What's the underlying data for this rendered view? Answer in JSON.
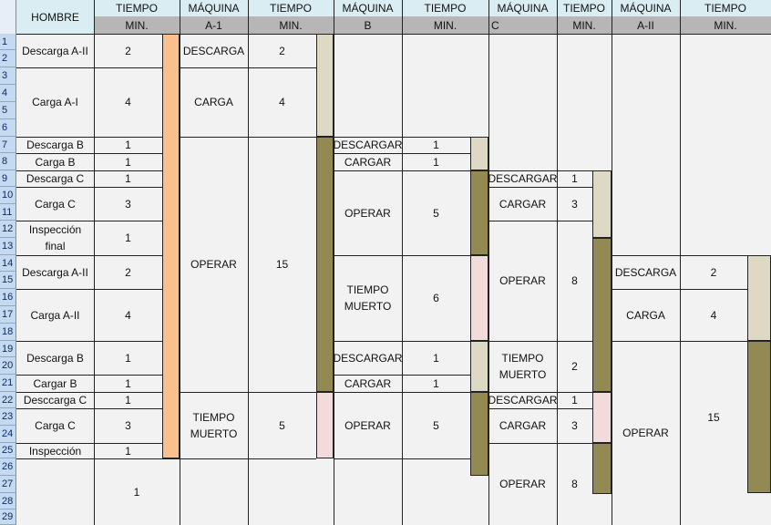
{
  "header": {
    "hombre": "HOMBRE",
    "tiempo": "TIEMPO",
    "min": "MIN.",
    "maquina": "MÁQUINA",
    "a1": "A-1",
    "b": "B",
    "c": "C",
    "a2": "A-II"
  },
  "rows": [
    "1",
    "2",
    "3",
    "4",
    "5",
    "6",
    "7",
    "8",
    "9",
    "10",
    "11",
    "12",
    "13",
    "14",
    "15",
    "16",
    "17",
    "18",
    "19",
    "20",
    "21",
    "22",
    "23",
    "24",
    "25",
    "26",
    "27",
    "28",
    "29"
  ],
  "hombre_col": [
    {
      "label": "Descarga A-II",
      "time": "2"
    },
    {
      "label": "Carga A-I",
      "time": "4"
    },
    {
      "label": "Descarga B",
      "time": "1"
    },
    {
      "label": "Carga B",
      "time": "1"
    },
    {
      "label": "Descarga C",
      "time": "1"
    },
    {
      "label": "Carga C",
      "time": "3"
    },
    {
      "label": "Inspección final",
      "time": "1"
    },
    {
      "label": "Descarga A-II",
      "time": "2"
    },
    {
      "label": "Carga A-II",
      "time": "4"
    },
    {
      "label": "Descarga B",
      "time": "1"
    },
    {
      "label": "Cargar B",
      "time": "1"
    },
    {
      "label": "Desccarga C",
      "time": "1"
    },
    {
      "label": "Carga C",
      "time": "3"
    },
    {
      "label": "Inspección",
      "time": "1"
    },
    {
      "label": "",
      "time": "1"
    }
  ],
  "a1_col": [
    {
      "label": "DESCARGA",
      "time": "2"
    },
    {
      "label": "CARGA",
      "time": "4"
    },
    {
      "label": "OPERAR",
      "time": "15"
    },
    {
      "label": "TIEMPO MUERTO",
      "time": "5"
    }
  ],
  "b_col": [
    {
      "label": "DESCARGAR",
      "time": "1"
    },
    {
      "label": "CARGAR",
      "time": "1"
    },
    {
      "label": "OPERAR",
      "time": "5"
    },
    {
      "label": "TIEMPO MUERTO",
      "time": "6"
    },
    {
      "label": "DESCARGAR",
      "time": "1"
    },
    {
      "label": "CARGAR",
      "time": "1"
    },
    {
      "label": "OPERAR",
      "time": "5"
    }
  ],
  "c_col": [
    {
      "label": "DESCARGAR",
      "time": "1"
    },
    {
      "label": "CARGAR",
      "time": "3"
    },
    {
      "label": "OPERAR",
      "time": "8"
    },
    {
      "label": "TIEMPO MUERTO",
      "time": "2"
    },
    {
      "label": "DESCARGAR",
      "time": "1"
    },
    {
      "label": "CARGAR",
      "time": "3"
    },
    {
      "label": "OPERAR",
      "time": "8"
    }
  ],
  "a2_col": [
    {
      "label": "DESCARGA",
      "time": "2"
    },
    {
      "label": "CARGA",
      "time": "4"
    },
    {
      "label": "OPERAR",
      "time": "15"
    }
  ],
  "colors": {
    "hombre_bar": "#f9bf8f",
    "load_unload": "#ddd9c4",
    "operate": "#938953",
    "idle": "#f2dcdb",
    "header_blue": "#d9edf3",
    "header_gray": "#b6b6b6",
    "row_header": "#c5d9f1"
  }
}
